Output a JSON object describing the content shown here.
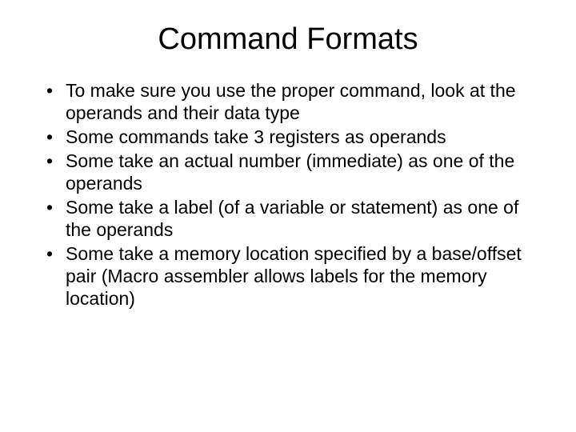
{
  "slide": {
    "title": "Command Formats",
    "bullets": [
      "To make sure you use the proper command, look at the operands and their data type",
      "Some commands take 3 registers as operands",
      "Some take an actual number (immediate) as one of the operands",
      "Some take a label (of a variable or statement) as one of the operands",
      "Some take a memory location specified by a base/offset pair (Macro assembler allows labels for the memory location)"
    ]
  }
}
